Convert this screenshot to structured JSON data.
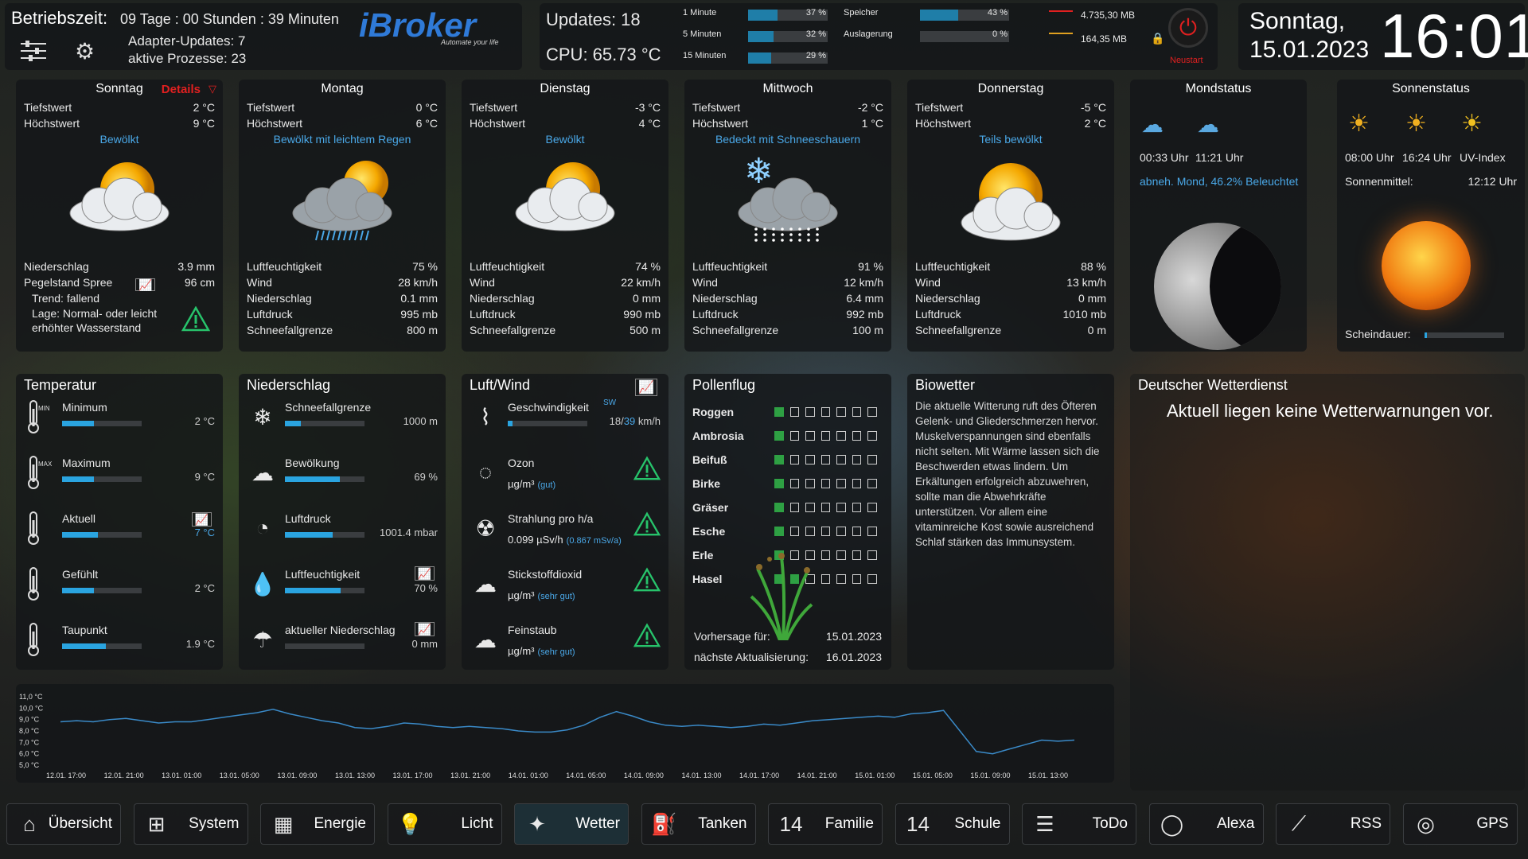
{
  "top_left": {
    "runtime_label": "Betriebszeit:",
    "runtime_value": "09 Tage : 00 Stunden : 39 Minuten",
    "adapter_updates": "Adapter-Updates: 7",
    "processes": "aktive Prozesse: 23",
    "logo_text": "Broker",
    "logo_prefix": "i",
    "logo_tagline": "Automate your life"
  },
  "top_mid": {
    "updates": "Updates: 18",
    "cpu": "CPU: 65.73 °C",
    "loads": [
      {
        "label": "1 Minute",
        "pct": 37,
        "text": "37 %"
      },
      {
        "label": "5 Minuten",
        "pct": 32,
        "text": "32 %"
      },
      {
        "label": "15 Minuten",
        "pct": 29,
        "text": "29 %"
      }
    ],
    "memory": [
      {
        "label": "Speicher",
        "pct": 43,
        "text": "43 %"
      },
      {
        "label": "Auslagerung",
        "pct": 0,
        "text": "0 %"
      }
    ],
    "mem_values": [
      "4.735,30 MB",
      "164,35 MB"
    ],
    "restart_label": "Neustart"
  },
  "top_right": {
    "day": "Sonntag,",
    "date": "15.01.2023",
    "time": "16:01"
  },
  "days": [
    {
      "name": "Sonntag",
      "details": "Details",
      "low_label": "Tiefstwert",
      "low": "2 °C",
      "high_label": "Höchstwert",
      "high": "9 °C",
      "cond": "Bewölkt",
      "icon": "cloud-sun",
      "rows": [
        [
          "Niederschlag",
          "3.9 mm"
        ],
        [
          "Pegelstand Spree",
          "96 cm"
        ]
      ],
      "trend": "Trend: fallend",
      "lage": "Lage: Normal- oder leicht erhöhter Wasserstand"
    },
    {
      "name": "Montag",
      "low_label": "Tiefstwert",
      "low": "0 °C",
      "high_label": "Höchstwert",
      "high": "6 °C",
      "cond": "Bewölkt mit leichtem Regen",
      "icon": "cloud-rain",
      "rows": [
        [
          "Luftfeuchtigkeit",
          "75 %"
        ],
        [
          "Wind",
          "28 km/h"
        ],
        [
          "Niederschlag",
          "0.1 mm"
        ],
        [
          "Luftdruck",
          "995 mb"
        ],
        [
          "Schneefallgrenze",
          "800 m"
        ]
      ]
    },
    {
      "name": "Dienstag",
      "low_label": "Tiefstwert",
      "low": "-3 °C",
      "high_label": "Höchstwert",
      "high": "4 °C",
      "cond": "Bewölkt",
      "icon": "cloud-sun",
      "rows": [
        [
          "Luftfeuchtigkeit",
          "74 %"
        ],
        [
          "Wind",
          "22 km/h"
        ],
        [
          "Niederschlag",
          "0 mm"
        ],
        [
          "Luftdruck",
          "990 mb"
        ],
        [
          "Schneefallgrenze",
          "500 m"
        ]
      ]
    },
    {
      "name": "Mittwoch",
      "low_label": "Tiefstwert",
      "low": "-2 °C",
      "high_label": "Höchstwert",
      "high": "1 °C",
      "cond": "Bedeckt mit Schneeschauern",
      "icon": "cloud-snow",
      "rows": [
        [
          "Luftfeuchtigkeit",
          "91 %"
        ],
        [
          "Wind",
          "12 km/h"
        ],
        [
          "Niederschlag",
          "6.4 mm"
        ],
        [
          "Luftdruck",
          "992 mb"
        ],
        [
          "Schneefallgrenze",
          "100 m"
        ]
      ]
    },
    {
      "name": "Donnerstag",
      "low_label": "Tiefstwert",
      "low": "-5 °C",
      "high_label": "Höchstwert",
      "high": "2 °C",
      "cond": "Teils bewölkt",
      "icon": "sun-cloud",
      "rows": [
        [
          "Luftfeuchtigkeit",
          "88 %"
        ],
        [
          "Wind",
          "13 km/h"
        ],
        [
          "Niederschlag",
          "0 mm"
        ],
        [
          "Luftdruck",
          "1010 mb"
        ],
        [
          "Schneefallgrenze",
          "0 m"
        ]
      ]
    }
  ],
  "moon": {
    "title": "Mondstatus",
    "rise": "00:33 Uhr",
    "set": "11:21 Uhr",
    "phase": "abneh. Mond, 46.2% Beleuchtet"
  },
  "sun": {
    "title": "Sonnenstatus",
    "rise": "08:00 Uhr",
    "set": "16:24 Uhr",
    "uv": "UV-Index",
    "noon_label": "Sonnenmittel:",
    "noon": "12:12 Uhr",
    "shine_label": "Scheindauer:",
    "shine_pct": 3
  },
  "temperatur": {
    "title": "Temperatur",
    "items": [
      {
        "label": "Minimum",
        "val": "2 °C",
        "pct": 40,
        "icon": "thermo-min-icon",
        "glyph": "MIN"
      },
      {
        "label": "Maximum",
        "val": "9 °C",
        "pct": 40,
        "icon": "thermo-max-icon",
        "glyph": "MAX"
      },
      {
        "label": "Aktuell",
        "val": "7 °C",
        "pct": 45,
        "icon": "thermometer-icon",
        "glyph": ""
      },
      {
        "label": "Gefühlt",
        "val": "2 °C",
        "pct": 40,
        "icon": "thermo-feels-icon",
        "glyph": ""
      },
      {
        "label": "Taupunkt",
        "val": "1.9 °C",
        "pct": 55,
        "icon": "thermo-dew-icon",
        "glyph": ""
      }
    ]
  },
  "niederschlag": {
    "title": "Niederschlag",
    "items": [
      {
        "label": "Schneefallgrenze",
        "val": "1000 m",
        "pct": 20,
        "icon": "snowflake-icon",
        "glyph": "❄"
      },
      {
        "label": "Bewölkung",
        "val": "69 %",
        "pct": 69,
        "icon": "cloud-icon",
        "glyph": "☁"
      },
      {
        "label": "Luftdruck",
        "val": "1001.4 mbar",
        "pct": 60,
        "icon": "gauge-icon",
        "glyph": "◔"
      },
      {
        "label": "Luftfeuchtigkeit",
        "val": "70 %",
        "pct": 70,
        "icon": "humidity-icon",
        "glyph": "💧"
      },
      {
        "label": "aktueller Niederschlag",
        "val": "0 mm",
        "pct": 0,
        "icon": "rain-icon",
        "glyph": "☂"
      }
    ]
  },
  "luft": {
    "title": "Luft/Wind",
    "items": [
      {
        "label": "Geschwindigkeit",
        "sub": "SW",
        "val": "18/",
        "val2": "39",
        "unit": " km/h",
        "pct": 6,
        "icon": "windsock-icon"
      },
      {
        "label": "Ozon",
        "val": "µg/m³",
        "quality": "(gut)",
        "icon": "ozone-icon"
      },
      {
        "label": "Strahlung pro h/a",
        "val": "0.099 µSv/h",
        "quality": "(0.867 mSv/a)",
        "icon": "radiation-icon"
      },
      {
        "label": "Stickstoffdioxid",
        "val": "µg/m³",
        "quality": "(sehr gut)",
        "icon": "no2-icon"
      },
      {
        "label": "Feinstaub",
        "val": "µg/m³",
        "quality": "(sehr gut)",
        "icon": "dust-icon"
      }
    ]
  },
  "pollen": {
    "title": "Pollenflug",
    "items": [
      {
        "name": "Roggen",
        "level": 1
      },
      {
        "name": "Ambrosia",
        "level": 1
      },
      {
        "name": "Beifuß",
        "level": 1
      },
      {
        "name": "Birke",
        "level": 1
      },
      {
        "name": "Gräser",
        "level": 1
      },
      {
        "name": "Esche",
        "level": 1
      },
      {
        "name": "Erle",
        "level": 1
      },
      {
        "name": "Hasel",
        "level": 2
      }
    ],
    "forecast_label": "Vorhersage für:",
    "forecast": "15.01.2023",
    "next_label": "nächste Aktualisierung:",
    "next": "16.01.2023"
  },
  "biowetter": {
    "title": "Biowetter",
    "text": "Die aktuelle Witterung ruft des Öfteren Gelenk- und Gliederschmerzen hervor. Muskelverspannungen sind ebenfalls nicht selten. Mit Wärme lassen sich die Beschwerden etwas lindern. Um Erkältungen erfolgreich abzuwehren, sollte man die Abwehrkräfte unterstützen. Vor allem eine vitaminreiche Kost sowie ausreichend Schlaf stärken das Immunsystem."
  },
  "dwd": {
    "title": "Deutscher Wetterdienst",
    "message": "Aktuell liegen keine Wetterwarnungen vor."
  },
  "chart_data": {
    "type": "line",
    "yticks": [
      "11,0 °C",
      "10,0 °C",
      "9,0 °C",
      "8,0 °C",
      "7,0 °C",
      "6,0 °C",
      "5,0 °C"
    ],
    "ylim": [
      5,
      11
    ],
    "xticks": [
      "12.01. 17:00",
      "12.01. 21:00",
      "13.01. 01:00",
      "13.01. 05:00",
      "13.01. 09:00",
      "13.01. 13:00",
      "13.01. 17:00",
      "13.01. 21:00",
      "14.01. 01:00",
      "14.01. 05:00",
      "14.01. 09:00",
      "14.01. 13:00",
      "14.01. 17:00",
      "14.01. 21:00",
      "15.01. 01:00",
      "15.01. 05:00",
      "15.01. 09:00",
      "15.01. 13:00"
    ],
    "series": [
      {
        "values": [
          8.8,
          8.9,
          8.8,
          9.0,
          9.1,
          8.9,
          8.7,
          8.8,
          8.8,
          9.0,
          9.2,
          9.4,
          9.6,
          9.9,
          9.5,
          9.2,
          8.9,
          8.7,
          8.3,
          8.2,
          8.4,
          8.7,
          8.6,
          8.4,
          8.3,
          8.4,
          8.3,
          8.2,
          8.0,
          7.9,
          7.9,
          8.1,
          8.5,
          9.2,
          9.7,
          9.3,
          8.8,
          8.5,
          8.4,
          8.5,
          8.4,
          8.3,
          8.4,
          8.6,
          8.5,
          8.7,
          8.9,
          9.0,
          9.1,
          9.2,
          9.3,
          9.2,
          9.5,
          9.6,
          9.8,
          8.0,
          6.2,
          6.0,
          6.4,
          6.8,
          7.2,
          7.1,
          7.2
        ]
      }
    ]
  },
  "nav": [
    {
      "label": "Übersicht",
      "icon": "home-icon",
      "glyph": "⌂"
    },
    {
      "label": "System",
      "icon": "network-icon",
      "glyph": "⊞"
    },
    {
      "label": "Energie",
      "icon": "meter-icon",
      "glyph": "▦"
    },
    {
      "label": "Licht",
      "icon": "lightbulb-icon",
      "glyph": "💡"
    },
    {
      "label": "Wetter",
      "icon": "weather-icon",
      "glyph": "✦",
      "active": true
    },
    {
      "label": "Tanken",
      "icon": "fuel-icon",
      "glyph": "⛽"
    },
    {
      "label": "Familie",
      "icon": "calendar-icon",
      "glyph": "14"
    },
    {
      "label": "Schule",
      "icon": "calendar-school-icon",
      "glyph": "14"
    },
    {
      "label": "ToDo",
      "icon": "list-icon",
      "glyph": "☰"
    },
    {
      "label": "Alexa",
      "icon": "alexa-icon",
      "glyph": "◯"
    },
    {
      "label": "RSS",
      "icon": "rss-icon",
      "glyph": "⟋"
    },
    {
      "label": "GPS",
      "icon": "gps-icon",
      "glyph": "◎"
    }
  ]
}
